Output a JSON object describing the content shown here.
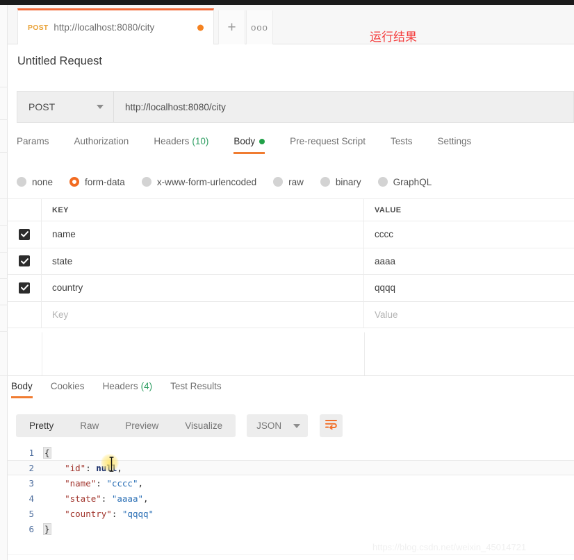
{
  "window": {
    "accent_orange": "#f26b21",
    "green": "#21a148",
    "annotation_red": "#f43b3b"
  },
  "tabstrip": {
    "request_tab": {
      "method": "POST",
      "url": "http://localhost:8080/city",
      "unsaved_indicator": "unsaved-dot"
    },
    "new_tab_label": "+",
    "more_label": "ooo",
    "annotation": "运行结果"
  },
  "request": {
    "title": "Untitled Request",
    "method": "POST",
    "url": "http://localhost:8080/city",
    "tabs": [
      {
        "label": "Params",
        "count": "",
        "active": false
      },
      {
        "label": "Authorization",
        "count": "",
        "active": false
      },
      {
        "label": "Headers",
        "count": "(10)",
        "active": false
      },
      {
        "label": "Body",
        "count": "",
        "active": true
      },
      {
        "label": "Pre-request Script",
        "count": "",
        "active": false
      },
      {
        "label": "Tests",
        "count": "",
        "active": false
      },
      {
        "label": "Settings",
        "count": "",
        "active": false
      }
    ],
    "body_types": [
      {
        "label": "none",
        "selected": false
      },
      {
        "label": "form-data",
        "selected": true
      },
      {
        "label": "x-www-form-urlencoded",
        "selected": false
      },
      {
        "label": "raw",
        "selected": false
      },
      {
        "label": "binary",
        "selected": false
      },
      {
        "label": "GraphQL",
        "selected": false
      }
    ],
    "table": {
      "headers": {
        "key": "KEY",
        "value": "VALUE"
      },
      "rows": [
        {
          "checked": true,
          "key": "name",
          "value": "cccc"
        },
        {
          "checked": true,
          "key": "state",
          "value": "aaaa"
        },
        {
          "checked": true,
          "key": "country",
          "value": "qqqq"
        }
      ],
      "placeholder_row": {
        "key": "Key",
        "value": "Value"
      }
    }
  },
  "response": {
    "tabs": [
      {
        "label": "Body",
        "count": "",
        "active": true
      },
      {
        "label": "Cookies",
        "count": "",
        "active": false
      },
      {
        "label": "Headers",
        "count": "(4)",
        "active": false
      },
      {
        "label": "Test Results",
        "count": "",
        "active": false
      }
    ],
    "view_modes": [
      {
        "label": "Pretty",
        "active": true
      },
      {
        "label": "Raw",
        "active": false
      },
      {
        "label": "Preview",
        "active": false
      },
      {
        "label": "Visualize",
        "active": false
      }
    ],
    "format": "JSON",
    "wrap_icon": "word-wrap-icon",
    "body_lines": [
      {
        "n": "1",
        "text": "{"
      },
      {
        "n": "2",
        "text": "    \"id\": null,"
      },
      {
        "n": "3",
        "text": "    \"name\": \"cccc\","
      },
      {
        "n": "4",
        "text": "    \"state\": \"aaaa\","
      },
      {
        "n": "5",
        "text": "    \"country\": \"qqqq\""
      },
      {
        "n": "6",
        "text": "}"
      }
    ]
  },
  "watermark": "https://blog.csdn.net/weixin_45014721"
}
